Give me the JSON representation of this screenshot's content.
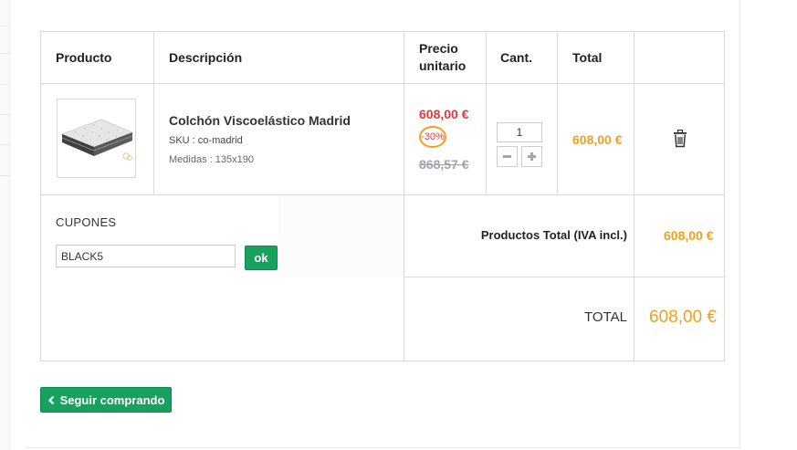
{
  "table": {
    "headers": {
      "product": "Producto",
      "description": "Descripción",
      "unit_price_line1": "Precio",
      "unit_price_line2": "unitario",
      "qty": "Cant.",
      "total": "Total"
    }
  },
  "item": {
    "image_icon": "mattress-image",
    "name": "Colchón Viscoelástico Madrid",
    "sku": "SKU : co-madrid",
    "size": "Medidas : 135x190",
    "price_new": "608,00 €",
    "discount": "-30%",
    "price_old": "868,57 €",
    "quantity": "1",
    "minus_icon": "minus-icon",
    "plus_icon": "plus-icon",
    "line_total": "608,00 €",
    "delete_icon": "trash-icon"
  },
  "coupons": {
    "title": "CUPONES",
    "value": "BLACK5",
    "apply_label": "ok"
  },
  "summary": {
    "subtotal_label": "Productos Total (IVA incl.)",
    "subtotal_value": "608,00 €",
    "total_label": "TOTAL",
    "total_value": "608,00 €"
  },
  "actions": {
    "continue_label": "Seguir comprando",
    "continue_icon": "chevron-left-icon"
  },
  "colors": {
    "accent_green": "#18a05e",
    "price_orange": "#f0a020",
    "price_red": "#e4393c",
    "old_price_grey": "#9ea6ae"
  }
}
